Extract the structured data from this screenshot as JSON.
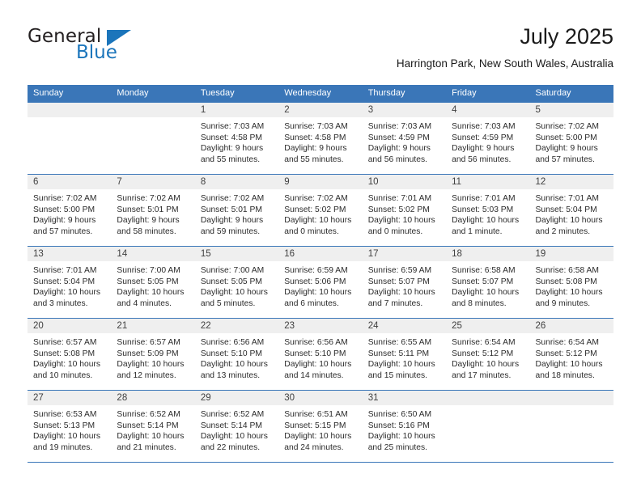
{
  "brand": {
    "word_one": "General",
    "word_two": "Blue",
    "logo_icon": "triangle-icon",
    "color_primary": "#1b75bb",
    "color_text": "#231f20"
  },
  "header": {
    "title": "July 2025",
    "subtitle": "Harrington Park, New South Wales, Australia"
  },
  "calendar": {
    "accent_color": "#3a76b8",
    "daynum_band_color": "#efefef",
    "weekdays": [
      "Sunday",
      "Monday",
      "Tuesday",
      "Wednesday",
      "Thursday",
      "Friday",
      "Saturday"
    ],
    "weeks": [
      [
        {
          "day": "",
          "sunrise": "",
          "sunset": "",
          "daylight_line1": "",
          "daylight_line2": ""
        },
        {
          "day": "",
          "sunrise": "",
          "sunset": "",
          "daylight_line1": "",
          "daylight_line2": ""
        },
        {
          "day": "1",
          "sunrise": "Sunrise: 7:03 AM",
          "sunset": "Sunset: 4:58 PM",
          "daylight_line1": "Daylight: 9 hours",
          "daylight_line2": "and 55 minutes."
        },
        {
          "day": "2",
          "sunrise": "Sunrise: 7:03 AM",
          "sunset": "Sunset: 4:58 PM",
          "daylight_line1": "Daylight: 9 hours",
          "daylight_line2": "and 55 minutes."
        },
        {
          "day": "3",
          "sunrise": "Sunrise: 7:03 AM",
          "sunset": "Sunset: 4:59 PM",
          "daylight_line1": "Daylight: 9 hours",
          "daylight_line2": "and 56 minutes."
        },
        {
          "day": "4",
          "sunrise": "Sunrise: 7:03 AM",
          "sunset": "Sunset: 4:59 PM",
          "daylight_line1": "Daylight: 9 hours",
          "daylight_line2": "and 56 minutes."
        },
        {
          "day": "5",
          "sunrise": "Sunrise: 7:02 AM",
          "sunset": "Sunset: 5:00 PM",
          "daylight_line1": "Daylight: 9 hours",
          "daylight_line2": "and 57 minutes."
        }
      ],
      [
        {
          "day": "6",
          "sunrise": "Sunrise: 7:02 AM",
          "sunset": "Sunset: 5:00 PM",
          "daylight_line1": "Daylight: 9 hours",
          "daylight_line2": "and 57 minutes."
        },
        {
          "day": "7",
          "sunrise": "Sunrise: 7:02 AM",
          "sunset": "Sunset: 5:01 PM",
          "daylight_line1": "Daylight: 9 hours",
          "daylight_line2": "and 58 minutes."
        },
        {
          "day": "8",
          "sunrise": "Sunrise: 7:02 AM",
          "sunset": "Sunset: 5:01 PM",
          "daylight_line1": "Daylight: 9 hours",
          "daylight_line2": "and 59 minutes."
        },
        {
          "day": "9",
          "sunrise": "Sunrise: 7:02 AM",
          "sunset": "Sunset: 5:02 PM",
          "daylight_line1": "Daylight: 10 hours",
          "daylight_line2": "and 0 minutes."
        },
        {
          "day": "10",
          "sunrise": "Sunrise: 7:01 AM",
          "sunset": "Sunset: 5:02 PM",
          "daylight_line1": "Daylight: 10 hours",
          "daylight_line2": "and 0 minutes."
        },
        {
          "day": "11",
          "sunrise": "Sunrise: 7:01 AM",
          "sunset": "Sunset: 5:03 PM",
          "daylight_line1": "Daylight: 10 hours",
          "daylight_line2": "and 1 minute."
        },
        {
          "day": "12",
          "sunrise": "Sunrise: 7:01 AM",
          "sunset": "Sunset: 5:04 PM",
          "daylight_line1": "Daylight: 10 hours",
          "daylight_line2": "and 2 minutes."
        }
      ],
      [
        {
          "day": "13",
          "sunrise": "Sunrise: 7:01 AM",
          "sunset": "Sunset: 5:04 PM",
          "daylight_line1": "Daylight: 10 hours",
          "daylight_line2": "and 3 minutes."
        },
        {
          "day": "14",
          "sunrise": "Sunrise: 7:00 AM",
          "sunset": "Sunset: 5:05 PM",
          "daylight_line1": "Daylight: 10 hours",
          "daylight_line2": "and 4 minutes."
        },
        {
          "day": "15",
          "sunrise": "Sunrise: 7:00 AM",
          "sunset": "Sunset: 5:05 PM",
          "daylight_line1": "Daylight: 10 hours",
          "daylight_line2": "and 5 minutes."
        },
        {
          "day": "16",
          "sunrise": "Sunrise: 6:59 AM",
          "sunset": "Sunset: 5:06 PM",
          "daylight_line1": "Daylight: 10 hours",
          "daylight_line2": "and 6 minutes."
        },
        {
          "day": "17",
          "sunrise": "Sunrise: 6:59 AM",
          "sunset": "Sunset: 5:07 PM",
          "daylight_line1": "Daylight: 10 hours",
          "daylight_line2": "and 7 minutes."
        },
        {
          "day": "18",
          "sunrise": "Sunrise: 6:58 AM",
          "sunset": "Sunset: 5:07 PM",
          "daylight_line1": "Daylight: 10 hours",
          "daylight_line2": "and 8 minutes."
        },
        {
          "day": "19",
          "sunrise": "Sunrise: 6:58 AM",
          "sunset": "Sunset: 5:08 PM",
          "daylight_line1": "Daylight: 10 hours",
          "daylight_line2": "and 9 minutes."
        }
      ],
      [
        {
          "day": "20",
          "sunrise": "Sunrise: 6:57 AM",
          "sunset": "Sunset: 5:08 PM",
          "daylight_line1": "Daylight: 10 hours",
          "daylight_line2": "and 10 minutes."
        },
        {
          "day": "21",
          "sunrise": "Sunrise: 6:57 AM",
          "sunset": "Sunset: 5:09 PM",
          "daylight_line1": "Daylight: 10 hours",
          "daylight_line2": "and 12 minutes."
        },
        {
          "day": "22",
          "sunrise": "Sunrise: 6:56 AM",
          "sunset": "Sunset: 5:10 PM",
          "daylight_line1": "Daylight: 10 hours",
          "daylight_line2": "and 13 minutes."
        },
        {
          "day": "23",
          "sunrise": "Sunrise: 6:56 AM",
          "sunset": "Sunset: 5:10 PM",
          "daylight_line1": "Daylight: 10 hours",
          "daylight_line2": "and 14 minutes."
        },
        {
          "day": "24",
          "sunrise": "Sunrise: 6:55 AM",
          "sunset": "Sunset: 5:11 PM",
          "daylight_line1": "Daylight: 10 hours",
          "daylight_line2": "and 15 minutes."
        },
        {
          "day": "25",
          "sunrise": "Sunrise: 6:54 AM",
          "sunset": "Sunset: 5:12 PM",
          "daylight_line1": "Daylight: 10 hours",
          "daylight_line2": "and 17 minutes."
        },
        {
          "day": "26",
          "sunrise": "Sunrise: 6:54 AM",
          "sunset": "Sunset: 5:12 PM",
          "daylight_line1": "Daylight: 10 hours",
          "daylight_line2": "and 18 minutes."
        }
      ],
      [
        {
          "day": "27",
          "sunrise": "Sunrise: 6:53 AM",
          "sunset": "Sunset: 5:13 PM",
          "daylight_line1": "Daylight: 10 hours",
          "daylight_line2": "and 19 minutes."
        },
        {
          "day": "28",
          "sunrise": "Sunrise: 6:52 AM",
          "sunset": "Sunset: 5:14 PM",
          "daylight_line1": "Daylight: 10 hours",
          "daylight_line2": "and 21 minutes."
        },
        {
          "day": "29",
          "sunrise": "Sunrise: 6:52 AM",
          "sunset": "Sunset: 5:14 PM",
          "daylight_line1": "Daylight: 10 hours",
          "daylight_line2": "and 22 minutes."
        },
        {
          "day": "30",
          "sunrise": "Sunrise: 6:51 AM",
          "sunset": "Sunset: 5:15 PM",
          "daylight_line1": "Daylight: 10 hours",
          "daylight_line2": "and 24 minutes."
        },
        {
          "day": "31",
          "sunrise": "Sunrise: 6:50 AM",
          "sunset": "Sunset: 5:16 PM",
          "daylight_line1": "Daylight: 10 hours",
          "daylight_line2": "and 25 minutes."
        },
        {
          "day": "",
          "sunrise": "",
          "sunset": "",
          "daylight_line1": "",
          "daylight_line2": ""
        },
        {
          "day": "",
          "sunrise": "",
          "sunset": "",
          "daylight_line1": "",
          "daylight_line2": ""
        }
      ]
    ]
  }
}
